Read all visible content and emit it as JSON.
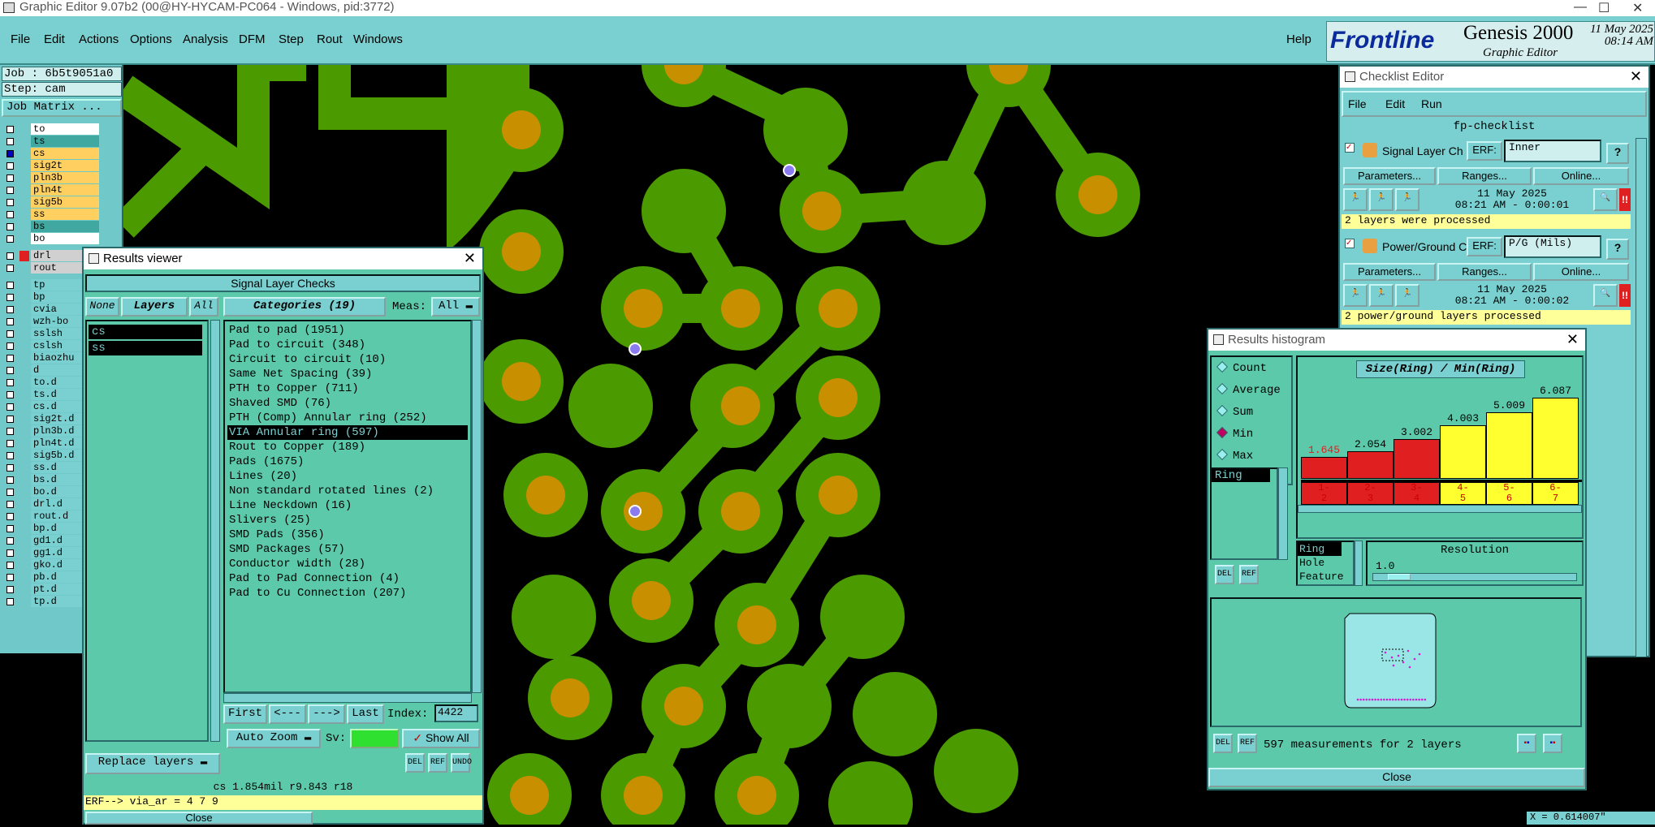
{
  "window": {
    "title": "Graphic Editor 9.07b2 (00@HY-HYCAM-PC064 - Windows, pid:3772)",
    "minimize": "—",
    "maximize": "☐",
    "close": "✕"
  },
  "menu": {
    "items": [
      "File",
      "Edit",
      "Actions",
      "Options",
      "Analysis",
      "DFM",
      "Step",
      "Rout",
      "Windows"
    ],
    "help": "Help"
  },
  "brand": {
    "logo": "Frontline",
    "product": "Genesis 2000",
    "subtitle": "Graphic Editor",
    "date": "11 May 2025",
    "time": "08:14 AM"
  },
  "left": {
    "job": "Job : 6b5t9051a0",
    "step": "Step: cam",
    "job_matrix": "Job Matrix ...",
    "layers": [
      {
        "name": "to",
        "color": "#ffffff"
      },
      {
        "name": "ts",
        "color": "#40a8a0"
      },
      {
        "name": "cs",
        "color": "#ffd060",
        "active": true
      },
      {
        "name": "sig2t",
        "color": "#ffd060"
      },
      {
        "name": "pln3b",
        "color": "#ffd060"
      },
      {
        "name": "pln4t",
        "color": "#ffd060"
      },
      {
        "name": "sig5b",
        "color": "#ffd060"
      },
      {
        "name": "ss",
        "color": "#ffd060"
      },
      {
        "name": "bs",
        "color": "#40a8a0"
      },
      {
        "name": "bo",
        "color": "#ffffff"
      },
      {
        "name": "drl",
        "color": "#d0d0d0",
        "mark": "#e02020"
      },
      {
        "name": "rout",
        "color": "#d0d0d0"
      },
      {
        "name": "tp",
        "color": "#7ad0d0"
      },
      {
        "name": "bp",
        "color": "#7ad0d0"
      },
      {
        "name": "cvia",
        "color": "#7ad0d0"
      },
      {
        "name": "wzh-bo",
        "color": "#7ad0d0"
      },
      {
        "name": "sslsh",
        "color": "#7ad0d0"
      },
      {
        "name": "cslsh",
        "color": "#7ad0d0"
      },
      {
        "name": "biaozhu",
        "color": "#7ad0d0"
      },
      {
        "name": "d",
        "color": "#7ad0d0"
      },
      {
        "name": "to.d",
        "color": "#7ad0d0"
      },
      {
        "name": "ts.d",
        "color": "#7ad0d0"
      },
      {
        "name": "cs.d",
        "color": "#7ad0d0"
      },
      {
        "name": "sig2t.d",
        "color": "#7ad0d0"
      },
      {
        "name": "pln3b.d",
        "color": "#7ad0d0"
      },
      {
        "name": "pln4t.d",
        "color": "#7ad0d0"
      },
      {
        "name": "sig5b.d",
        "color": "#7ad0d0"
      },
      {
        "name": "ss.d",
        "color": "#7ad0d0"
      },
      {
        "name": "bs.d",
        "color": "#7ad0d0"
      },
      {
        "name": "bo.d",
        "color": "#7ad0d0"
      },
      {
        "name": "drl.d",
        "color": "#7ad0d0"
      },
      {
        "name": "rout.d",
        "color": "#7ad0d0"
      },
      {
        "name": "bp.d",
        "color": "#7ad0d0"
      },
      {
        "name": "gd1.d",
        "color": "#7ad0d0"
      },
      {
        "name": "gg1.d",
        "color": "#7ad0d0"
      },
      {
        "name": "gko.d",
        "color": "#7ad0d0"
      },
      {
        "name": "pb.d",
        "color": "#7ad0d0"
      },
      {
        "name": "pt.d",
        "color": "#7ad0d0"
      },
      {
        "name": "tp.d",
        "color": "#7ad0d0"
      }
    ]
  },
  "results_viewer": {
    "title": "Results viewer",
    "header": "Signal Layer Checks",
    "none": "None",
    "layers": "Layers",
    "all": "All",
    "categories_btn": "Categories (19)",
    "meas_label": "Meas:",
    "meas_value": "All",
    "layer_list": [
      "cs",
      "ss"
    ],
    "categories": [
      "Pad to pad (1951)",
      "Pad to circuit (348)",
      "Circuit to circuit (10)",
      "Same Net Spacing (39)",
      "PTH to Copper (711)",
      "Shaved SMD (76)",
      "PTH (Comp) Annular ring (252)",
      "VIA Annular ring (597)",
      "Rout to Copper (189)",
      "Pads (1675)",
      "Lines (20)",
      "Non standard rotated lines (2)",
      "Line Neckdown (16)",
      "Slivers (25)",
      "SMD Pads (356)",
      "SMD Packages (57)",
      "Conductor width (28)",
      "Pad to Pad Connection (4)",
      "Pad to Cu Connection (207)"
    ],
    "selected_index": 7,
    "first": "First",
    "prev": "<---",
    "next": "--->",
    "last": "Last",
    "index_label": "Index:",
    "index_value": "4422",
    "auto_zoom": "Auto Zoom",
    "sv_label": "Sv:",
    "show_all": "Show All",
    "replace_layers": "Replace layers",
    "del": "DEL",
    "ref": "REF",
    "undo": "UNDO",
    "status": "cs 1.854mil   r9.843   r18",
    "erf": "ERF--> via_ar = 4 7 9",
    "close": "Close"
  },
  "checklist": {
    "title": "Checklist Editor",
    "menu": [
      "File",
      "Edit",
      "Run"
    ],
    "name": "fp-checklist",
    "checks": [
      {
        "name": "Signal Layer Ch",
        "erf": "ERF:",
        "erf_value": "Inner",
        "date": "11 May 2025",
        "time": "08:21 AM - 0:00:01",
        "msg": "2 layers were processed"
      },
      {
        "name": "Power/Ground C",
        "erf": "ERF:",
        "erf_value": "P/G (Mils)",
        "date": "11 May 2025",
        "time": "08:21 AM - 0:00:02",
        "msg": "2 power/ground layers processed"
      }
    ],
    "parameters": "Parameters...",
    "ranges": "Ranges...",
    "online": "Online...",
    "help": "?",
    "bang": "!!"
  },
  "histogram": {
    "title": "Results histogram",
    "modes": [
      "Count",
      "Average",
      "Sum",
      "Min",
      "Max"
    ],
    "selected_mode": "Min",
    "measure": "Ring",
    "chart_title": "Size(Ring) / Min(Ring)",
    "bars": [
      {
        "range": "1-2",
        "value": "1.645",
        "level": 0.27,
        "color": "#e02020",
        "label_color": "#e02020"
      },
      {
        "range": "2-3",
        "value": "2.054",
        "level": 0.34,
        "color": "#e02020",
        "label_color": "#000"
      },
      {
        "range": "3-4",
        "value": "3.002",
        "level": 0.49,
        "color": "#e02020",
        "label_color": "#000"
      },
      {
        "range": "4-5",
        "value": "4.003",
        "level": 0.66,
        "color": "#ffff30",
        "label_color": "#000"
      },
      {
        "range": "5-6",
        "value": "5.009",
        "level": 0.82,
        "color": "#ffff30",
        "label_color": "#000"
      },
      {
        "range": "6-7",
        "value": "6.087",
        "level": 1.0,
        "color": "#ffff30",
        "label_color": "#000"
      }
    ],
    "type_list": [
      "Ring",
      "Hole",
      "Feature"
    ],
    "resolution_label": "Resolution",
    "resolution_value": "1.0",
    "measurements": "597 measurements for 2 layers",
    "close": "Close"
  },
  "coords": "X = 0.614007\"",
  "colors": {
    "board": "#000000",
    "copper": "#4a9a00",
    "pad": "#c89000",
    "panel": "#5ccaaa",
    "frame": "#7ad0d0"
  }
}
